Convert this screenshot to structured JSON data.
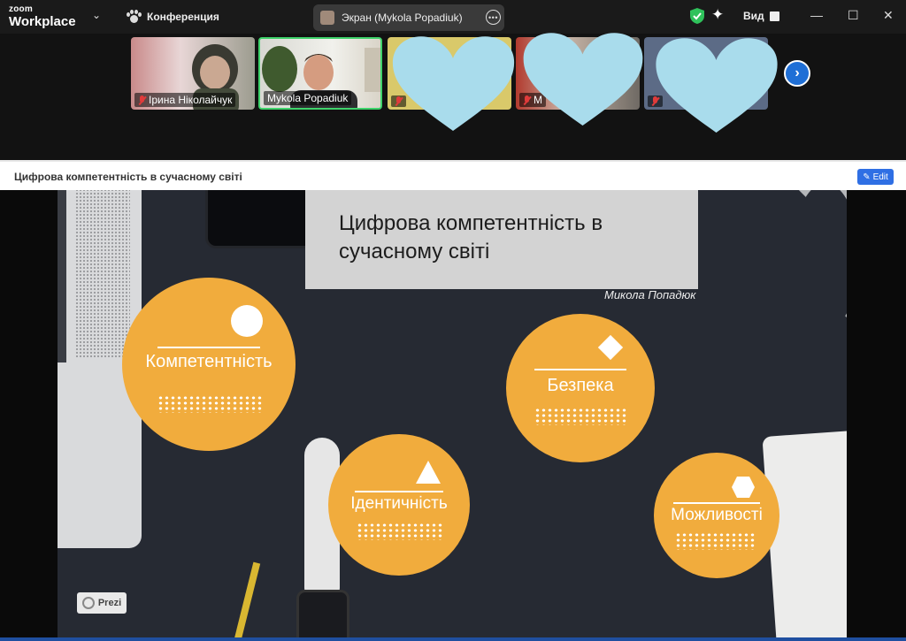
{
  "app": {
    "logo_top": "zoom",
    "logo_bottom": "Workplace",
    "meeting_name": "Конференция"
  },
  "screen_share": {
    "label": "Экран (Mykola Popadiuk)"
  },
  "toolbar": {
    "view_label": "Вид"
  },
  "participants": [
    {
      "name": "Ірина Ніколайчук",
      "muted": true
    },
    {
      "name": "Mykola Popadiuk",
      "muted": false,
      "active": true
    },
    {
      "name": "",
      "muted": true
    },
    {
      "name": "M",
      "muted": true
    },
    {
      "name": "",
      "muted": true
    }
  ],
  "prezi": {
    "title": "Цифрова компетентність в сучасному світі",
    "edit_label": "Edit",
    "badge": "Prezi"
  },
  "slide": {
    "title": "Цифрова компетентність в сучасному світі",
    "author": "Микола Попадюк",
    "topics": {
      "competence": "Компетентність",
      "security": "Безпека",
      "identity": "Ідентичність",
      "opportunities": "Можливості"
    }
  },
  "colors": {
    "accent_orange": "#f1ac3d",
    "slide_bg": "#262a33",
    "heart": "#a9dcec",
    "active_border": "#3fd36b",
    "edit_blue": "#2f6fe4"
  }
}
